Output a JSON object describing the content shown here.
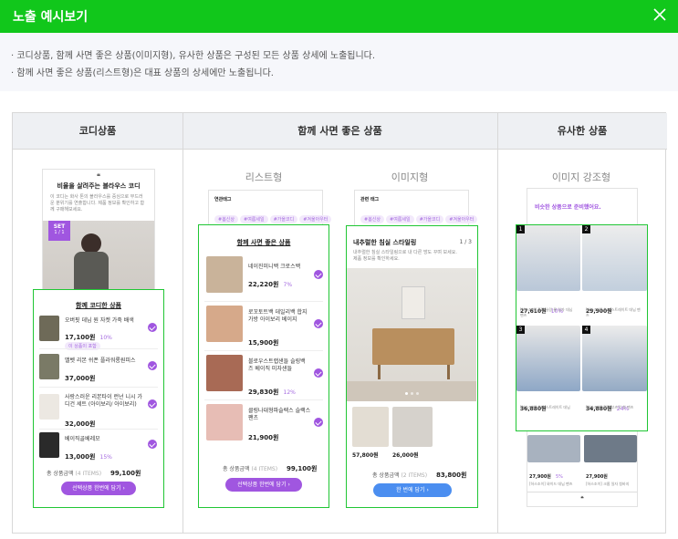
{
  "header": {
    "title": "노출 예시보기"
  },
  "notes": [
    "· 코디상품, 함께 사면 좋은 상품(이미지형), 유사한 상품은 구성된 모든 상품 상세에 노출됩니다.",
    "· 함께 사면 좋은 상품(리스트형)은 대표 상품의 상세에만 노출됩니다."
  ],
  "columns": [
    "코디상품",
    "함께 사면 좋은 상품",
    "유사한 상품"
  ],
  "subtitles": {
    "list": "리스트형",
    "image": "이미지형",
    "similar": "이미지 강조형"
  },
  "codi": {
    "heading": "비율을 살려주는 블라우스 코디",
    "desc": "이 코디는 화사 톤의 블라우스를 중심으로 부드러운 분위기를 연출합니다. 제품 정보를 확인하고 함께 구매해보세요.",
    "set_badge": "SET",
    "set_count": "1 / 1",
    "panel_title": "함께 코디한 상품",
    "items": [
      {
        "name": "오버핏 데님 원 자켓 가죽 배색",
        "price": "17,100원",
        "pct": "10%",
        "tag": "이 상품이 포함"
      },
      {
        "name": "밸벳 리본 쉬폰 플라워롱원피스",
        "price": "37,000원",
        "pct": ""
      },
      {
        "name": "사랑스러운 리본타이 런넌 니시 가디건 세트 (아이보리/ 아이보리)",
        "price": "32,000원",
        "pct": ""
      },
      {
        "name": "베이직골베레모",
        "price": "13,000원",
        "pct": "15%"
      }
    ],
    "total_label": "총 상품금액",
    "total_items": "(4 ITEMS)",
    "total_price": "99,100원",
    "button": "선택상품 한번에 담기 ›"
  },
  "list_type": {
    "tabs_title": "연관태그",
    "tags": [
      "#봄신상",
      "#여름세일",
      "#가을코디",
      "#겨울아우터"
    ],
    "panel_title": "함께 사면 좋은 상품",
    "items": [
      {
        "name": "네이진미니백 크로스백",
        "price": "22,220원",
        "pct": "7%"
      },
      {
        "name": "로꼬토트백 데일리백 합지가방 아이보리 베이지",
        "price": "15,900원",
        "pct": ""
      },
      {
        "name": "블로우스트랩샌들 슬링백 즈 베이직 미자샌들",
        "price": "29,830원",
        "pct": "12%"
      },
      {
        "name": "클링나대형파슬렉스 슬랙스 팬츠",
        "price": "21,900원",
        "pct": ""
      }
    ],
    "total_label": "총 상품금액",
    "total_items": "(4 ITEMS)",
    "total_price": "99,100원",
    "button": "선택상품 한번에 담기 ›"
  },
  "image_type": {
    "tabs_title": "관련 태그",
    "tags": [
      "#봄신상",
      "#여름세일",
      "#가을코디",
      "#겨울아우터"
    ],
    "panel_title": "내추럴한 침실 스타일링",
    "page": "1 / 3",
    "desc": "내추럴한 침실 스타일링으로 내 다른 방도 꾸며 보세요. 제품 정보를 확인하세요.",
    "prices": [
      "57,800원",
      "26,000원"
    ],
    "total_label": "총 상품금액",
    "total_items": "(2 ITEMS)",
    "total_price": "83,800원",
    "button": "한 번에 담기 ›"
  },
  "similar": {
    "heading": "비슷한 상품으로 준비했어요.",
    "items": [
      {
        "num": "1",
        "price": "27,610원",
        "pct": "10%",
        "desc": "[하스조이] 쪼쪼 슬림 롱 일자 데님 팬츠"
      },
      {
        "num": "2",
        "price": "29,900원",
        "pct": "",
        "desc": "[하스조이] 하스 스트레이트 데님 팬츠"
      },
      {
        "num": "3",
        "price": "36,880원",
        "pct": "",
        "desc": "[하스조이] 하이 스트레이트 데님"
      },
      {
        "num": "4",
        "price": "34,880원",
        "pct": "24%",
        "desc": "[하스조이] 웜핏 부츠컷 청 팬츠"
      }
    ],
    "extra": [
      {
        "price": "27,900원",
        "pct": "5%",
        "desc": "[하스조이] 와이드 데님 팬츠"
      },
      {
        "price": "27,900원",
        "pct": "",
        "desc": "[하스조이] 크롭 일자 청바지"
      }
    ],
    "quote": "❝"
  },
  "colors": {
    "header": "#11c71b",
    "select_border": "#20c634",
    "accent": "#a056e0",
    "blue_button": "#4b8ef0"
  }
}
